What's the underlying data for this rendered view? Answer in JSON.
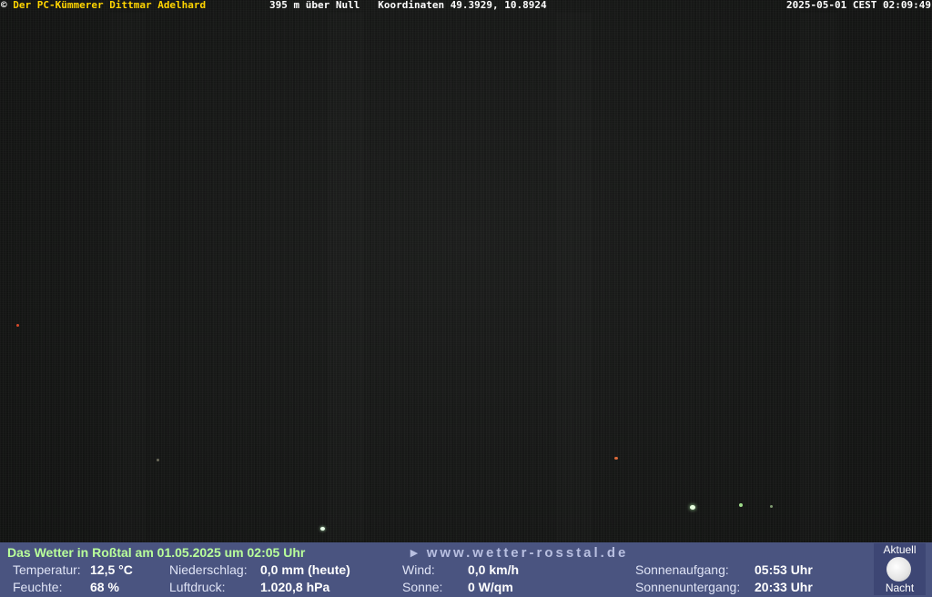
{
  "overlay": {
    "copyright_symbol": "©",
    "author": "Der PC-Kümmerer Dittmar Adelhard",
    "altitude": "395 m über Null",
    "coordinates": "Koordinaten 49.3929, 10.8924",
    "datetime": "2025-05-01 CEST 02:09:49"
  },
  "weather": {
    "heading": "Das Wetter in Roßtal am 01.05.2025 um 02:05 Uhr",
    "website": "▸ www.wetter-rosstal.de",
    "temperature_label": "Temperatur:",
    "temperature_value": "12,5 °C",
    "humidity_label": "Feuchte:",
    "humidity_value": "68 %",
    "precipitation_label": "Niederschlag:",
    "precipitation_value": "0,0 mm (heute)",
    "pressure_label": "Luftdruck:",
    "pressure_value": "1.020,8 hPa",
    "wind_label": "Wind:",
    "wind_value": "0,0 km/h",
    "sun_label": "Sonne:",
    "sun_value": "0 W/qm",
    "sunrise_label": "Sonnenaufgang:",
    "sunrise_value": "05:53 Uhr",
    "sunset_label": "Sonnenuntergang:",
    "sunset_value": "20:33 Uhr"
  },
  "moon_status": {
    "top_label": "Aktuell",
    "bottom_label": "Nacht",
    "icon": "full-moon-icon"
  },
  "colors": {
    "sky": "#161716",
    "panel": "#4a5480",
    "heading_green": "#b9ff9a",
    "overlay_yellow": "#ffd400"
  }
}
